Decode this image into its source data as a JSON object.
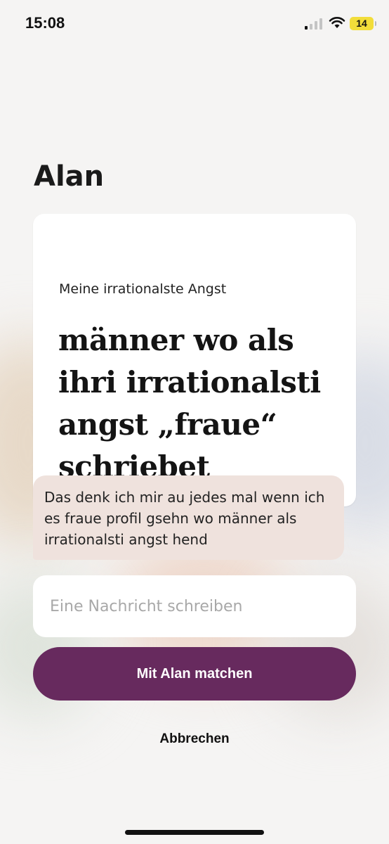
{
  "status_bar": {
    "time": "15:08",
    "battery": "14"
  },
  "profile": {
    "name": "Alan"
  },
  "prompt": {
    "label": "Meine irrationalste Angst",
    "answer": "männer wo als ihri irrationalsti angst „fraue“ schriebet"
  },
  "comment": {
    "text": "Das denk ich mir au jedes mal wenn ich es fraue profil gsehn wo männer als irrationalsti angst hend"
  },
  "message_input": {
    "placeholder": "Eine Nachricht schreiben",
    "value": ""
  },
  "actions": {
    "match_label": "Mit Alan matchen",
    "cancel_label": "Abbrechen"
  },
  "colors": {
    "accent": "#672a5e",
    "comment_bubble": "#efe2dd",
    "battery": "#f2dd3a"
  }
}
